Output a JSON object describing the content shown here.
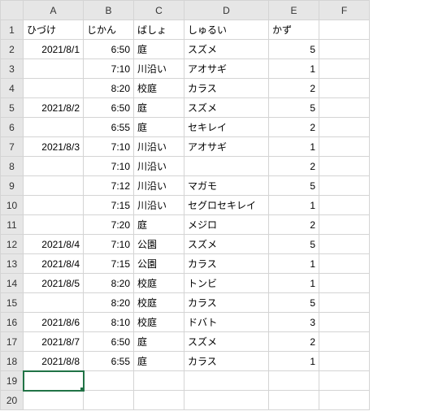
{
  "columns": [
    "A",
    "B",
    "C",
    "D",
    "E",
    "F"
  ],
  "rowCount": 20,
  "activeCell": {
    "row": 19,
    "col": "A"
  },
  "headers": {
    "A": "ひづけ",
    "B": "じかん",
    "C": "ばしょ",
    "D": "しゅるい",
    "E": "かず"
  },
  "rows": [
    {
      "A": "2021/8/1",
      "B": "6:50",
      "C": "庭",
      "D": "スズメ",
      "E": "5"
    },
    {
      "A": "",
      "B": "7:10",
      "C": "川沿い",
      "D": "アオサギ",
      "E": "1"
    },
    {
      "A": "",
      "B": "8:20",
      "C": "校庭",
      "D": "カラス",
      "E": "2"
    },
    {
      "A": "2021/8/2",
      "B": "6:50",
      "C": "庭",
      "D": "スズメ",
      "E": "5"
    },
    {
      "A": "",
      "B": "6:55",
      "C": "庭",
      "D": "セキレイ",
      "E": "2"
    },
    {
      "A": "2021/8/3",
      "B": "7:10",
      "C": "川沿い",
      "D": "アオサギ",
      "E": "1"
    },
    {
      "A": "",
      "B": "7:10",
      "C": "川沿い",
      "D": "",
      "E": "2"
    },
    {
      "A": "",
      "B": "7:12",
      "C": "川沿い",
      "D": "マガモ",
      "E": "5"
    },
    {
      "A": "",
      "B": "7:15",
      "C": "川沿い",
      "D": "セグロセキレイ",
      "E": "1"
    },
    {
      "A": "",
      "B": "7:20",
      "C": "庭",
      "D": "メジロ",
      "E": "2"
    },
    {
      "A": "2021/8/4",
      "B": "7:10",
      "C": "公園",
      "D": "スズメ",
      "E": "5"
    },
    {
      "A": "2021/8/4",
      "B": "7:15",
      "C": "公園",
      "D": "カラス",
      "E": "1"
    },
    {
      "A": "2021/8/5",
      "B": "8:20",
      "C": "校庭",
      "D": "トンビ",
      "E": "1"
    },
    {
      "A": "",
      "B": "8:20",
      "C": "校庭",
      "D": "カラス",
      "E": "5"
    },
    {
      "A": "2021/8/6",
      "B": "8:10",
      "C": "校庭",
      "D": "ドバト",
      "E": "3"
    },
    {
      "A": "2021/8/7",
      "B": "6:50",
      "C": "庭",
      "D": "スズメ",
      "E": "2"
    },
    {
      "A": "2021/8/8",
      "B": "6:55",
      "C": "庭",
      "D": "カラス",
      "E": "1"
    }
  ],
  "chart_data": {
    "type": "table",
    "title": "",
    "columns": [
      "ひづけ",
      "じかん",
      "ばしょ",
      "しゅるい",
      "かず"
    ],
    "data": [
      [
        "2021/8/1",
        "6:50",
        "庭",
        "スズメ",
        5
      ],
      [
        "",
        "7:10",
        "川沿い",
        "アオサギ",
        1
      ],
      [
        "",
        "8:20",
        "校庭",
        "カラス",
        2
      ],
      [
        "2021/8/2",
        "6:50",
        "庭",
        "スズメ",
        5
      ],
      [
        "",
        "6:55",
        "庭",
        "セキレイ",
        2
      ],
      [
        "2021/8/3",
        "7:10",
        "川沿い",
        "アオサギ",
        1
      ],
      [
        "",
        "7:10",
        "川沿い",
        "",
        2
      ],
      [
        "",
        "7:12",
        "川沿い",
        "マガモ",
        5
      ],
      [
        "",
        "7:15",
        "川沿い",
        "セグロセキレイ",
        1
      ],
      [
        "",
        "7:20",
        "庭",
        "メジロ",
        2
      ],
      [
        "2021/8/4",
        "7:10",
        "公園",
        "スズメ",
        5
      ],
      [
        "2021/8/4",
        "7:15",
        "公園",
        "カラス",
        1
      ],
      [
        "2021/8/5",
        "8:20",
        "校庭",
        "トンビ",
        1
      ],
      [
        "",
        "8:20",
        "校庭",
        "カラス",
        5
      ],
      [
        "2021/8/6",
        "8:10",
        "校庭",
        "ドバト",
        3
      ],
      [
        "2021/8/7",
        "6:50",
        "庭",
        "スズメ",
        2
      ],
      [
        "2021/8/8",
        "6:55",
        "庭",
        "カラス",
        1
      ]
    ]
  }
}
